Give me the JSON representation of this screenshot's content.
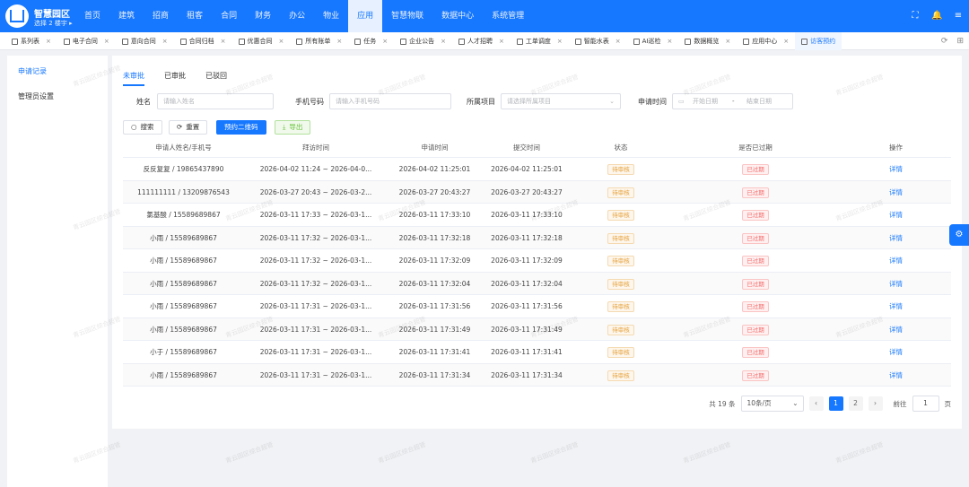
{
  "header": {
    "brand": "智慧园区",
    "building_selector": "选择 2 楼宇 ▸",
    "nav": [
      "首页",
      "建筑",
      "招商",
      "租客",
      "合同",
      "财务",
      "办公",
      "物业",
      "应用",
      "智慧物联",
      "数据中心",
      "系统管理"
    ],
    "active_nav": "应用"
  },
  "tabs": [
    {
      "label": "系列表"
    },
    {
      "label": "电子合同"
    },
    {
      "label": "意向合同"
    },
    {
      "label": "合同归档"
    },
    {
      "label": "优惠合同"
    },
    {
      "label": "所有账单"
    },
    {
      "label": "任务"
    },
    {
      "label": "企业公告"
    },
    {
      "label": "人才招聘"
    },
    {
      "label": "工单调度"
    },
    {
      "label": "智能水表"
    },
    {
      "label": "AI巡检"
    },
    {
      "label": "数据概览"
    },
    {
      "label": "应用中心"
    },
    {
      "label": "访客预约"
    }
  ],
  "sidebar": {
    "items": [
      {
        "label": "申请记录",
        "active": true
      },
      {
        "label": "管理员设置",
        "active": false
      }
    ]
  },
  "subtabs": [
    {
      "label": "未审批",
      "active": true
    },
    {
      "label": "已审批",
      "active": false
    },
    {
      "label": "已驳回",
      "active": false
    }
  ],
  "filters": {
    "name_label": "姓名",
    "name_placeholder": "请输入姓名",
    "phone_label": "手机号码",
    "phone_placeholder": "请输入手机号码",
    "project_label": "所属项目",
    "project_placeholder": "请选择所属项目",
    "date_label": "申请时间",
    "start_placeholder": "开始日期",
    "date_separator": "-",
    "end_placeholder": "结束日期"
  },
  "buttons": {
    "search": "搜索",
    "reset": "重置",
    "qrcode": "预约二维码",
    "export": "导出"
  },
  "table": {
    "headers": [
      "申请人姓名/手机号",
      "拜访时间",
      "申请时间",
      "提交时间",
      "状态",
      "是否已过期",
      "操作"
    ],
    "rows": [
      {
        "applicant": "反反复复 / 19865437890",
        "visit": "2026-04-02 11:24 ~ 2026-04-0...",
        "applied": "2026-04-02 11:25:01",
        "submitted": "2026-04-02 11:25:01",
        "status": "待审核",
        "expired": "已过期",
        "action": "详情"
      },
      {
        "applicant": "111111111 / 13209876543",
        "visit": "2026-03-27 20:43 ~ 2026-03-2...",
        "applied": "2026-03-27 20:43:27",
        "submitted": "2026-03-27 20:43:27",
        "status": "待审核",
        "expired": "已过期",
        "action": "详情"
      },
      {
        "applicant": "氯基酸 / 15589689867",
        "visit": "2026-03-11 17:33 ~ 2026-03-1...",
        "applied": "2026-03-11 17:33:10",
        "submitted": "2026-03-11 17:33:10",
        "status": "待审核",
        "expired": "已过期",
        "action": "详情"
      },
      {
        "applicant": "小雨 / 15589689867",
        "visit": "2026-03-11 17:32 ~ 2026-03-1...",
        "applied": "2026-03-11 17:32:18",
        "submitted": "2026-03-11 17:32:18",
        "status": "待审核",
        "expired": "已过期",
        "action": "详情"
      },
      {
        "applicant": "小雨 / 15589689867",
        "visit": "2026-03-11 17:32 ~ 2026-03-1...",
        "applied": "2026-03-11 17:32:09",
        "submitted": "2026-03-11 17:32:09",
        "status": "待审核",
        "expired": "已过期",
        "action": "详情"
      },
      {
        "applicant": "小雨 / 15589689867",
        "visit": "2026-03-11 17:32 ~ 2026-03-1...",
        "applied": "2026-03-11 17:32:04",
        "submitted": "2026-03-11 17:32:04",
        "status": "待审核",
        "expired": "已过期",
        "action": "详情"
      },
      {
        "applicant": "小雨 / 15589689867",
        "visit": "2026-03-11 17:31 ~ 2026-03-1...",
        "applied": "2026-03-11 17:31:56",
        "submitted": "2026-03-11 17:31:56",
        "status": "待审核",
        "expired": "已过期",
        "action": "详情"
      },
      {
        "applicant": "小雨 / 15589689867",
        "visit": "2026-03-11 17:31 ~ 2026-03-1...",
        "applied": "2026-03-11 17:31:49",
        "submitted": "2026-03-11 17:31:49",
        "status": "待审核",
        "expired": "已过期",
        "action": "详情"
      },
      {
        "applicant": "小于 / 15589689867",
        "visit": "2026-03-11 17:31 ~ 2026-03-1...",
        "applied": "2026-03-11 17:31:41",
        "submitted": "2026-03-11 17:31:41",
        "status": "待审核",
        "expired": "已过期",
        "action": "详情"
      },
      {
        "applicant": "小雨 / 15589689867",
        "visit": "2026-03-11 17:31 ~ 2026-03-1...",
        "applied": "2026-03-11 17:31:34",
        "submitted": "2026-03-11 17:31:34",
        "status": "待审核",
        "expired": "已过期",
        "action": "详情"
      }
    ]
  },
  "pagination": {
    "total": "共 19 条",
    "page_size": "10条/页",
    "prev": "‹",
    "pages": [
      "1",
      "2"
    ],
    "current": "1",
    "next": "›",
    "goto_label": "前往",
    "goto_value": "1",
    "page_suffix": "页"
  },
  "watermark_text": "青云园区综合超管",
  "colors": {
    "primary": "#1677ff",
    "warning": "#e6a23c",
    "danger": "#f56c6c",
    "success": "#67c23a"
  }
}
